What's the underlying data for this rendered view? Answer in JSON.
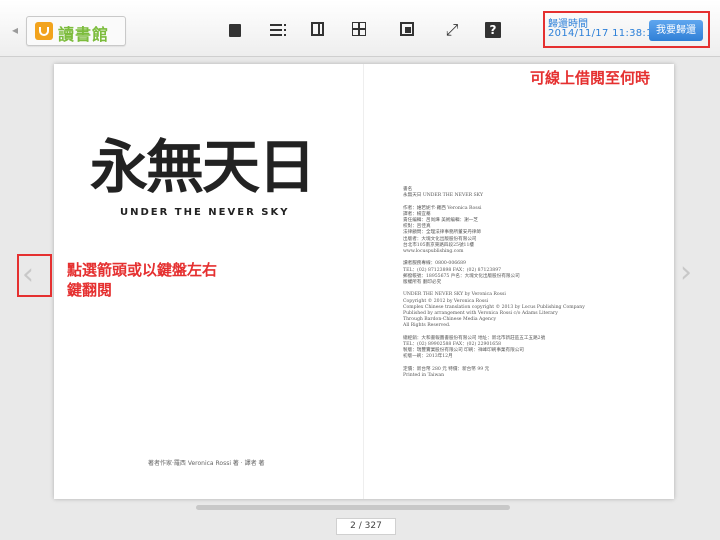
{
  "app": {
    "logo_text": "讀書館",
    "logo_back_glyph": "◂"
  },
  "toolbar": {
    "icons": [
      "single-page-icon",
      "list-view-icon",
      "two-page-icon",
      "thumbnail-grid-icon",
      "fit-page-icon",
      "fullscreen-icon",
      "help-icon"
    ],
    "fullscreen_glyph": "⤢",
    "help_glyph": "?"
  },
  "loan": {
    "label": "歸還時間",
    "date": "2014/11/17 11:38:12",
    "return_button": "我要歸還"
  },
  "page": {
    "title_cn": "永無天日",
    "title_en": "UNDER THE NEVER SKY",
    "credit": "著者作家·羅西 Veronica Rossi 著 · 譯者 著",
    "copyright": "書名\n永無天日 UNDER THE NEVER SKY\n\n作者：維若妮卡·羅西 Veronica Rossi\n譯者：楊宜蓁\n責任編輯：呂尚燁  美術編輯：謝一芝\n校對：呂佳真\n法律顧問：全理法律事務所董安丹律師\n出版者：大塊文化出版股份有限公司\n台北市105南京東路四段25號11樓\nwww.locuspublishing.com\n\n讀者服務專線：0800-006689\nTEL：(02) 87123898  FAX：(02) 87123897\n郵撥帳號：18955675  戶名：大塊文化出版股份有限公司\n版權所有 翻印必究\n\nUNDER THE NEVER SKY by Veronica Rossi\nCopyright © 2012 by Veronica Rossi\nComplex Chinese translation copyright © 2013 by Locus Publishing Company\nPublished by arrangement with Veronica Rossi c/o Adams Literary\nThrough Bardon-Chinese Media Agency\nAll Rights Reserved.\n\n總經銷：大和書報圖書股份有限公司  地址：新北市新莊區五工五路2號\nTEL：(02) 89902588  FAX：(02) 22901658\n製版：瑞豐實業股份有限公司  印刷：祥峰印刷事業有限公司\n初版一刷：2013年12月\n\n定價：新台幣 280 元  特價：新台幣 99 元\nPrinted in Taiwan"
  },
  "annotations": {
    "upper": "可線上借閱至何時",
    "left": "點選箭頭或以鍵盤左右鍵翻閱"
  },
  "navigation": {
    "prev_glyph": "‹",
    "next_glyph": "›",
    "page_counter": "2 / 327"
  },
  "colors": {
    "annotation_red": "#e53030",
    "link_blue": "#2b7fd8",
    "logo_green": "#7cbc3c",
    "logo_orange": "#f2a31d"
  }
}
